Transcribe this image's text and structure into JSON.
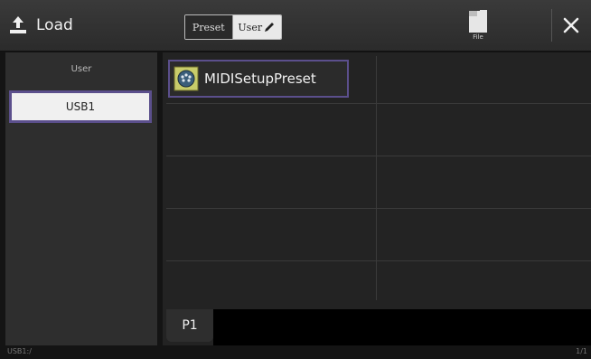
{
  "header": {
    "load_label": "Load",
    "tabs": {
      "preset_label": "Preset",
      "user_label": "User"
    },
    "file_label": "File"
  },
  "left_panel": {
    "header_label": "User",
    "items": [
      {
        "label": "USB1",
        "selected": true
      }
    ]
  },
  "main": {
    "presets": [
      {
        "label": "MIDISetupPreset",
        "icon": "midi-setup-icon"
      }
    ],
    "page_tab": "P1"
  },
  "status": {
    "path": "USB1:/",
    "page": "1/1"
  },
  "colors": {
    "selection_border": "#5b4f8c",
    "background": "#141414",
    "panel": "#2e2e2e"
  }
}
